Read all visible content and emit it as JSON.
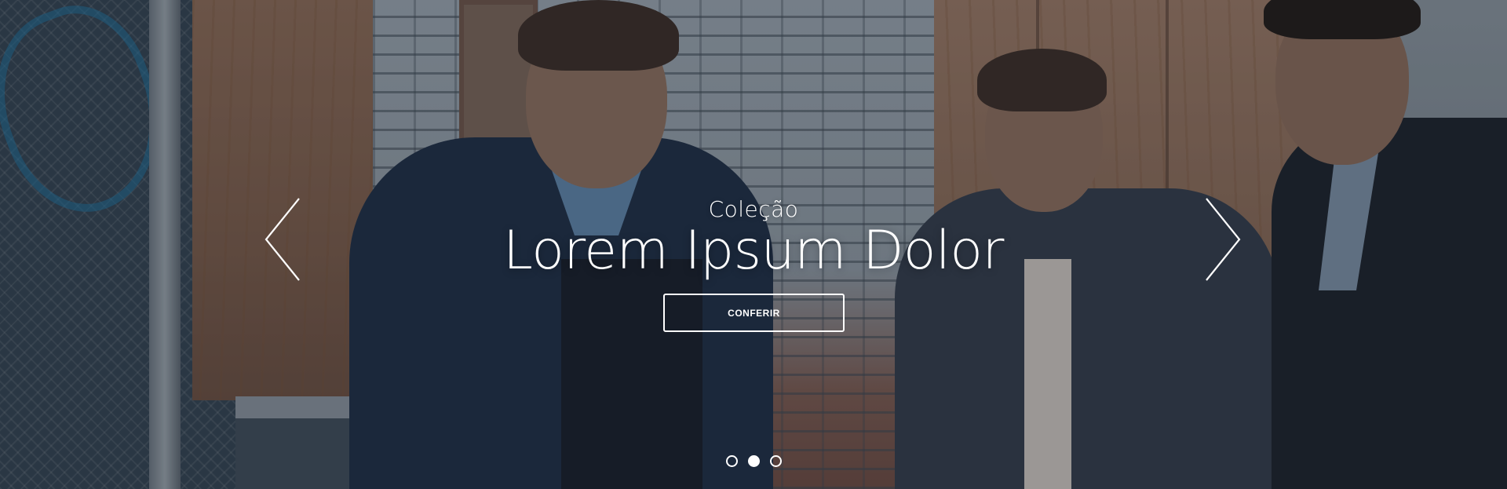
{
  "slide": {
    "subtitle": "Coleção",
    "title": "Lorem Ipsum Dolor",
    "cta_label": "CONFERIR"
  },
  "controls": {
    "prev_icon": "chevron-left-icon",
    "next_icon": "chevron-right-icon",
    "dots_count": 3,
    "active_dot": 2
  },
  "colors": {
    "text": "#ffffff",
    "overlay": "#141c26"
  }
}
